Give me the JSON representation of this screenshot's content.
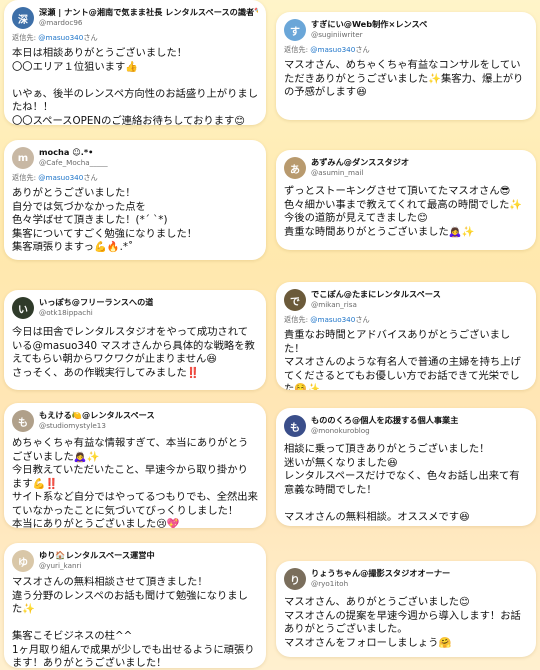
{
  "reply_prefix": "返信先:",
  "cards": [
    {
      "name": "深瀬 | ナント@湘南で気まま社長 レンタルスペースの識者✏️と呼ばれ",
      "handle": "@mardoc96",
      "reply_mention": "@masuo340",
      "reply_suffix": "さん",
      "text": "本日は相談ありがとうございました！\n〇〇エリア１位狙います👍\n\nいやぁ、後半のレンスペ方向性のお話盛り上がりましたね！！\n〇〇スペースOPENのご連絡お待ちしております😊",
      "avatar_glyph": "深",
      "avatar_color": "#3d6fa8"
    },
    {
      "name": "すぎにい@Web制作×レンスペ",
      "handle": "@suginiiwriter",
      "reply_mention": "@masuo340",
      "reply_suffix": "さん",
      "text": "マスオさん、めちゃくちゃ有益なコンサルをしていただきありがとうございました✨集客力、爆上がりの予感がします😆",
      "avatar_glyph": "す",
      "avatar_color": "#6aa6d8"
    },
    {
      "name": "mocha ☺︎.*•",
      "handle": "@Cafe_Mocha_____",
      "reply_mention": "@masuo340",
      "reply_suffix": "さん",
      "text": "ありがとうございました！\n自分では気づかなかった点を\n色々学ばせて頂きました！(*´ `*)\n集客についてすごく勉強になりました！\n集客頑張りますっ💪🔥.*˚",
      "avatar_glyph": "m",
      "avatar_color": "#c8b8a4"
    },
    {
      "name": "あずみん@ダンススタジオ",
      "handle": "@asumin_mail",
      "reply_mention": "",
      "reply_suffix": "",
      "text": "ずっとストーキングさせて頂いてたマスオさん😎\n色々細かい事まで教えてくれて最高の時間でした✨\n今後の道筋が見えてきました😊\n貴重な時間ありがとうございました🙇‍♀️✨",
      "avatar_glyph": "あ",
      "avatar_color": "#b89a6e"
    },
    {
      "name": "いっぽち@フリーランスへの道",
      "handle": "@otk18ippachi",
      "reply_mention": "",
      "reply_suffix": "",
      "text": "今日は田舎でレンタルスタジオをやって成功されている@masuo340 マスオさんから具体的な戦略を教えてもらい朝からワクワクが止まりません😆\nさっそく、あの作戦実行してみました‼️",
      "avatar_glyph": "い",
      "avatar_color": "#2f3b2a"
    },
    {
      "name": "でこぽん@たまにレンタルスペース",
      "handle": "@mikan_risa",
      "reply_mention": "@masuo340",
      "reply_suffix": "さん",
      "text": "貴重なお時間とアドバイスありがとうございました！\nマスオさんのような有名人で普通の主婦を持ち上げてくださるとてもお優しい方でお話できて光栄でした☺️✨",
      "avatar_glyph": "で",
      "avatar_color": "#6b5a3a"
    },
    {
      "name": "もえける🍋@レンタルスペース",
      "handle": "@studiomystyle13",
      "reply_mention": "",
      "reply_suffix": "",
      "text": "めちゃくちゃ有益な情報すぎて、本当にありがとうございました🙇‍♀️✨\n今日教えていただいたこと、早速今から取り掛かります💪‼️\nサイト系など自分ではやってるつもりでも、全然出来ていなかったことに気づいてびっくりしました！\n本当にありがとうございました😢💖",
      "avatar_glyph": "も",
      "avatar_color": "#b0a08a"
    },
    {
      "name": "もののくろ@個人を応援する個人事業主",
      "handle": "@monokuroblog",
      "reply_mention": "",
      "reply_suffix": "",
      "text": "相談に乗って頂きありがとうございました！\n迷いが無くなりました😆\nレンタルスペースだけでなく、色々お話し出来て有意義な時間でした！\n\nマスオさんの無料相談。オススメです😆",
      "avatar_glyph": "も",
      "avatar_color": "#3a4e8a"
    },
    {
      "name": "ゆり🏠レンタルスペース運営中",
      "handle": "@yuri_kanri",
      "reply_mention": "",
      "reply_suffix": "",
      "text": "マスオさんの無料相談させて頂きました！\n違う分野のレンスペのお話も聞けて勉強になりました✨\n\n集客こそビジネスの柱^^\n1ヶ月取り組んで成果が少しでも出せるように頑張ります！ありがとうございました！",
      "avatar_glyph": "ゆ",
      "avatar_color": "#d9c7a8"
    },
    {
      "name": "りょうちゃん@撮影スタジオオーナー",
      "handle": "@ryo1itoh",
      "reply_mention": "",
      "reply_suffix": "",
      "text": "マスオさん、ありがとうございました😊\nマスオさんの提案を早速今週から導入します！お話ありがとうございました。\nマスオさんをフォローしましょう🤗",
      "avatar_glyph": "り",
      "avatar_color": "#7a6e5c"
    }
  ]
}
